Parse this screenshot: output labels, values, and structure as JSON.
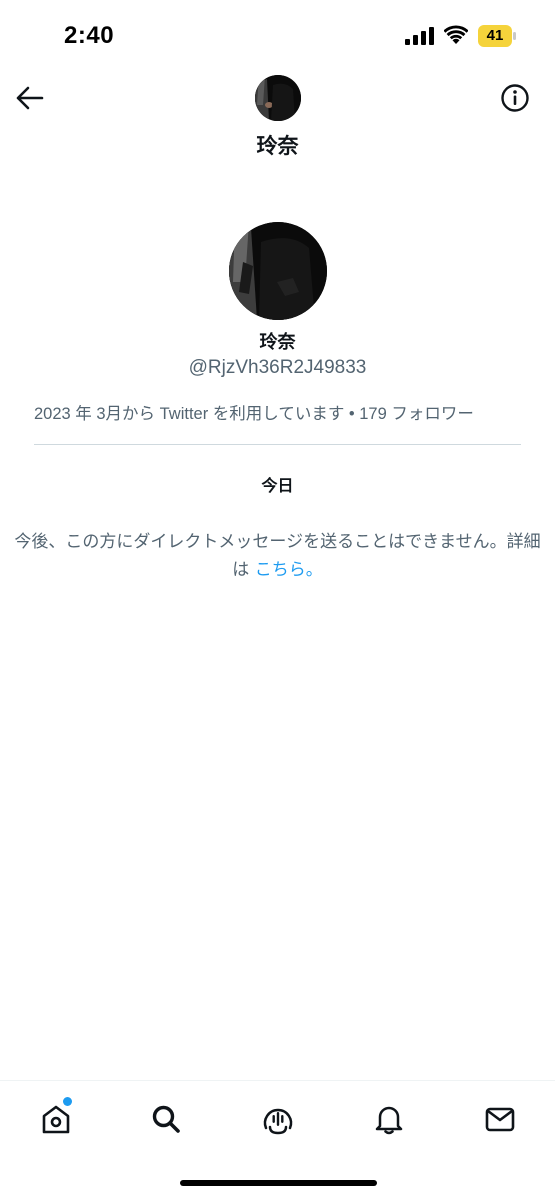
{
  "status_bar": {
    "time": "2:40",
    "battery_level": "41",
    "icons": [
      "cellular-signal-icon",
      "wifi-icon",
      "battery-icon"
    ]
  },
  "header": {
    "title": "玲奈",
    "back_icon": "arrow-left-icon",
    "info_icon": "info-icon"
  },
  "profile": {
    "name": "玲奈",
    "handle": "@RjzVh36R2J49833",
    "meta": "2023 年 3月から Twitter を利用しています • 179 フォロワー"
  },
  "conversation": {
    "date_label": "今日",
    "notice_text": "今後、この方にダイレクトメッセージを送ることはできません。詳細は ",
    "notice_link": "こちら。"
  },
  "bottom_nav": {
    "items": [
      {
        "icon": "home-icon",
        "has_notification_dot": true
      },
      {
        "icon": "search-icon"
      },
      {
        "icon": "spaces-icon"
      },
      {
        "icon": "bell-icon"
      },
      {
        "icon": "mail-icon"
      }
    ]
  },
  "colors": {
    "accent": "#1d9bf0",
    "secondary_text": "#536471",
    "battery_fill": "#f5d33b"
  }
}
